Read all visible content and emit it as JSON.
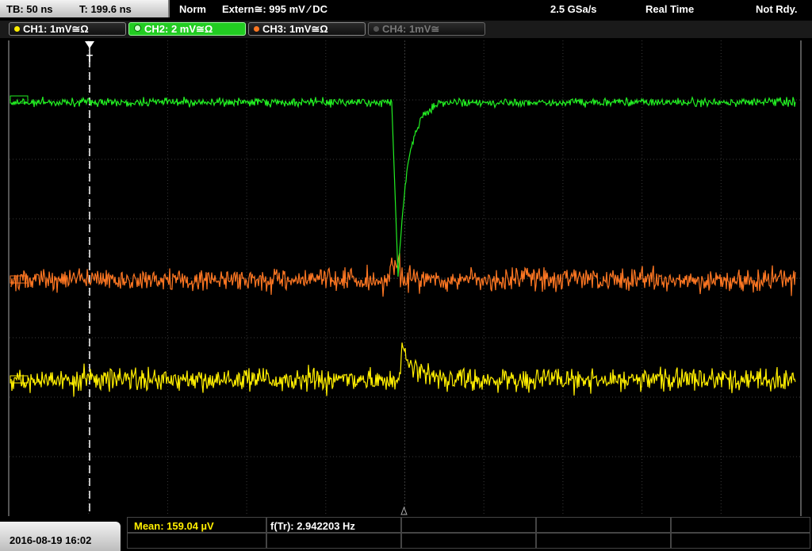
{
  "top": {
    "timebase": "TB: 50 ns",
    "trigger_time": "T: 199.6 ns",
    "trigger_mode": "Norm",
    "trigger_source": "Extern≅: 995 mV ⁄ DC",
    "sample_rate": "2.5 GSa/s",
    "acq_mode": "Real Time",
    "status": "Not Rdy."
  },
  "channels": [
    {
      "label": "CH1: 1mV≅Ω",
      "color": "#ffee00",
      "state": "on"
    },
    {
      "label": "CH2: 2 mV≅Ω",
      "color": "#22dd22",
      "state": "active"
    },
    {
      "label": "CH3: 1mV≅Ω",
      "color": "#ff7722",
      "state": "on"
    },
    {
      "label": "CH4: 1mV≅",
      "color": "#777777",
      "state": "off"
    }
  ],
  "trigger_marker": "T",
  "measurements": {
    "mean": "Mean: 159.04 µV",
    "freq": "f(Tr): 2.942203 Hz"
  },
  "datetime": "2016-08-19 16:02",
  "colors": {
    "ch1": "#ffee00",
    "ch2": "#22ee22",
    "ch3": "#ff7722",
    "grid": "#333333"
  }
}
